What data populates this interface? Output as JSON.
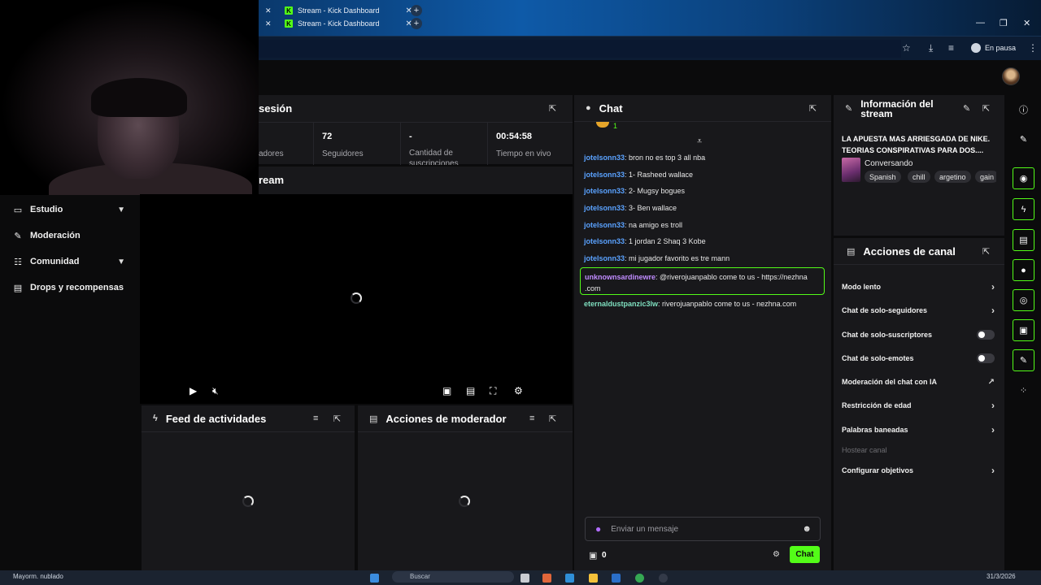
{
  "browser": {
    "tabs": [
      {
        "title": "Stream - Kick Dashboard"
      },
      {
        "title": "Stream - Kick Dashboard"
      }
    ],
    "profile_label": "En pausa"
  },
  "sidebar": {
    "items": [
      {
        "label": "Estudio",
        "icon": "studio-icon",
        "has_chevron": true
      },
      {
        "label": "Moderación",
        "icon": "wrench-icon",
        "has_chevron": false
      },
      {
        "label": "Comunidad",
        "icon": "users-icon",
        "has_chevron": true
      },
      {
        "label": "Drops y recompensas",
        "icon": "chart-icon",
        "has_chevron": false
      }
    ]
  },
  "session": {
    "title_partial": "sesión",
    "stats": [
      {
        "value": "",
        "label": "adores"
      },
      {
        "value": "72",
        "label": "Seguidores"
      },
      {
        "value": "-",
        "label": "Cantidad de suscripciones"
      },
      {
        "value": "00:54:58",
        "label": "Tiempo en vivo"
      }
    ]
  },
  "stream_panel": {
    "title_partial": "ream"
  },
  "activity_feed": {
    "title": "Feed de actividades"
  },
  "mod_actions": {
    "title": "Acciones de moderador"
  },
  "chat": {
    "title": "Chat",
    "pinned_count": "1",
    "messages": [
      {
        "user": "jotelsonn33",
        "text": ": bron no es top 3 all nba"
      },
      {
        "user": "jotelsonn33",
        "text": ": 1- Rasheed wallace"
      },
      {
        "user": "jotelsonn33",
        "text": ": 2- Mugsy bogues"
      },
      {
        "user": "jotelsonn33",
        "text": ": 3- Ben wallace"
      },
      {
        "user": "jotelsonn33",
        "text": ": na amigo es troll"
      },
      {
        "user": "jotelsonn33",
        "text": ": 1 jordan 2 Shaq 3 Kobe"
      },
      {
        "user": "jotelsonn33",
        "text": ": mi jugador favorito es tre mann"
      }
    ],
    "highlighted": {
      "user": "unknownsardinewre",
      "text": ": @riverojuanpablo come to us - https://nezhna",
      "text2": ".com"
    },
    "last": {
      "user": "eternaldustpanzic3lw",
      "text": ": riverojuanpablo come to us - nezhna.com"
    },
    "input_placeholder": "Enviar un mensaje",
    "points": "0",
    "send_label": "Chat",
    "colors": {
      "user": "#5aa2ff",
      "accent": "#53fc18",
      "mention_user": "#c08cff",
      "last_user": "#7fe0c0"
    }
  },
  "stream_info": {
    "title": "Información del stream",
    "stream_title": "LA APUESTA MAS ARRIESGADA DE NIKE. TEORIAS CONSPIRATIVAS PARA DOS....",
    "category": "Conversando",
    "tags": [
      "Spanish",
      "chill",
      "argetino",
      "gain"
    ]
  },
  "channel_actions": {
    "title": "Acciones de canal",
    "items": [
      {
        "label": "Modo lento",
        "control": "chevron"
      },
      {
        "label": "Chat de solo-seguidores",
        "control": "chevron"
      },
      {
        "label": "Chat de solo-suscriptores",
        "control": "toggle"
      },
      {
        "label": "Chat de solo-emotes",
        "control": "toggle"
      },
      {
        "label": "Moderación del chat con IA",
        "control": "external"
      },
      {
        "label": "Restricción de edad",
        "control": "chevron"
      },
      {
        "label": "Palabras baneadas",
        "control": "chevron"
      },
      {
        "label": "Hostear canal",
        "control": "disabled"
      },
      {
        "label": "Configurar objetivos",
        "control": "chevron"
      }
    ]
  },
  "taskbar": {
    "weather": "Mayorm. nublado",
    "search_placeholder": "Buscar",
    "date": "31/3/2026"
  }
}
